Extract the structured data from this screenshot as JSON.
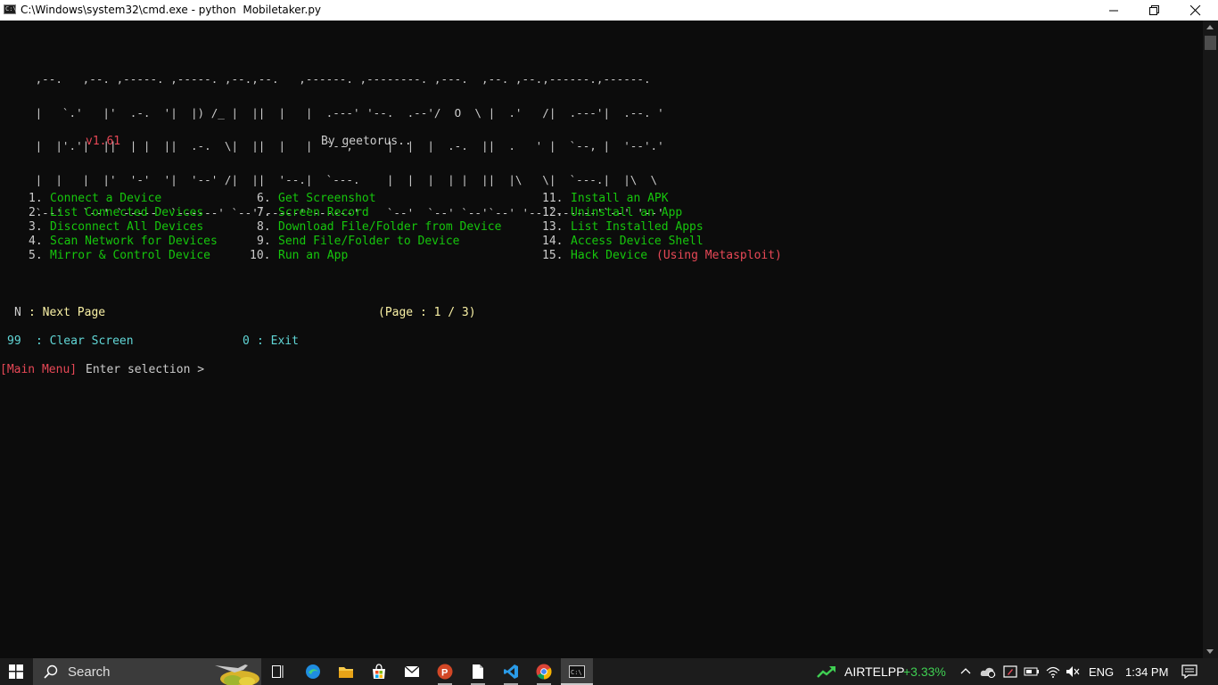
{
  "window": {
    "title": "C:\\Windows\\system32\\cmd.exe - python  Mobiletaker.py",
    "icon_text": "C:\\"
  },
  "banner": {
    "ascii_lines": [
      " ,--.   ,--. ,-----. ,-----. ,--.,--.   ,------. ,--------. ,---.  ,--. ,--.,------.,------.",
      " |   `.'   |'  .-.  '|  |) /_ |  ||  |   |  .---' '--.  .--'/  O  \\ |  .'   /|  .---'|  .--. '",
      " |  |'.'|  ||  | |  ||  .-.  \\|  ||  |   |  `--,     |  |  |  .-.  ||  .   ' |  `--, |  '--'.'",
      " |  |   |  |'  '-'  '|  '--' /|  ||  '--.|  `---.    |  |  |  | |  ||  |\\   \\|  `---.|  |\\  \\",
      " `--'   `--' `-----' `------' `--'`-----'`------'    `--'  `--' `--'`--' '--'`------'`--' '--'"
    ],
    "version": "v1.61",
    "author": "By geetorus.."
  },
  "menu": {
    "col1": [
      {
        "num": "1.",
        "label": "Connect a Device"
      },
      {
        "num": "2.",
        "label": "List Connected Devices"
      },
      {
        "num": "3.",
        "label": "Disconnect All Devices"
      },
      {
        "num": "4.",
        "label": "Scan Network for Devices"
      },
      {
        "num": "5.",
        "label": "Mirror & Control Device"
      }
    ],
    "col2": [
      {
        "num": "6.",
        "label": "Get Screenshot"
      },
      {
        "num": "7.",
        "label": "Screen Record"
      },
      {
        "num": "8.",
        "label": "Download File/Folder from Device"
      },
      {
        "num": "9.",
        "label": "Send File/Folder to Device"
      },
      {
        "num": "10.",
        "label": "Run an App"
      }
    ],
    "col3": [
      {
        "num": "11.",
        "label": "Install an APK"
      },
      {
        "num": "12.",
        "label": "Uninstall an App"
      },
      {
        "num": "13.",
        "label": "List Installed Apps"
      },
      {
        "num": "14.",
        "label": "Access Device Shell"
      },
      {
        "num": "15.",
        "label": "Hack Device",
        "extra": "(Using Metasploit)"
      }
    ]
  },
  "nav": {
    "next_key": "N",
    "next_label": ": Next Page",
    "page_info": "(Page : 1 / 3)",
    "clear_key": "99",
    "clear_label": ": Clear Screen",
    "exit_key": "0",
    "exit_label": ": Exit"
  },
  "prompt": {
    "context": "[Main Menu]",
    "text": "Enter selection >"
  },
  "taskbar": {
    "search_label": "Search",
    "stock_name": "AIRTELPP",
    "stock_change": "+3.33%",
    "language": "ENG",
    "time": "1:34 PM"
  },
  "colors": {
    "green": "#16c60c",
    "red": "#e74856",
    "yellow": "#f9f1a5",
    "cyan": "#61d6d6",
    "text": "#cccccc",
    "stock_up": "#3fcf52"
  }
}
